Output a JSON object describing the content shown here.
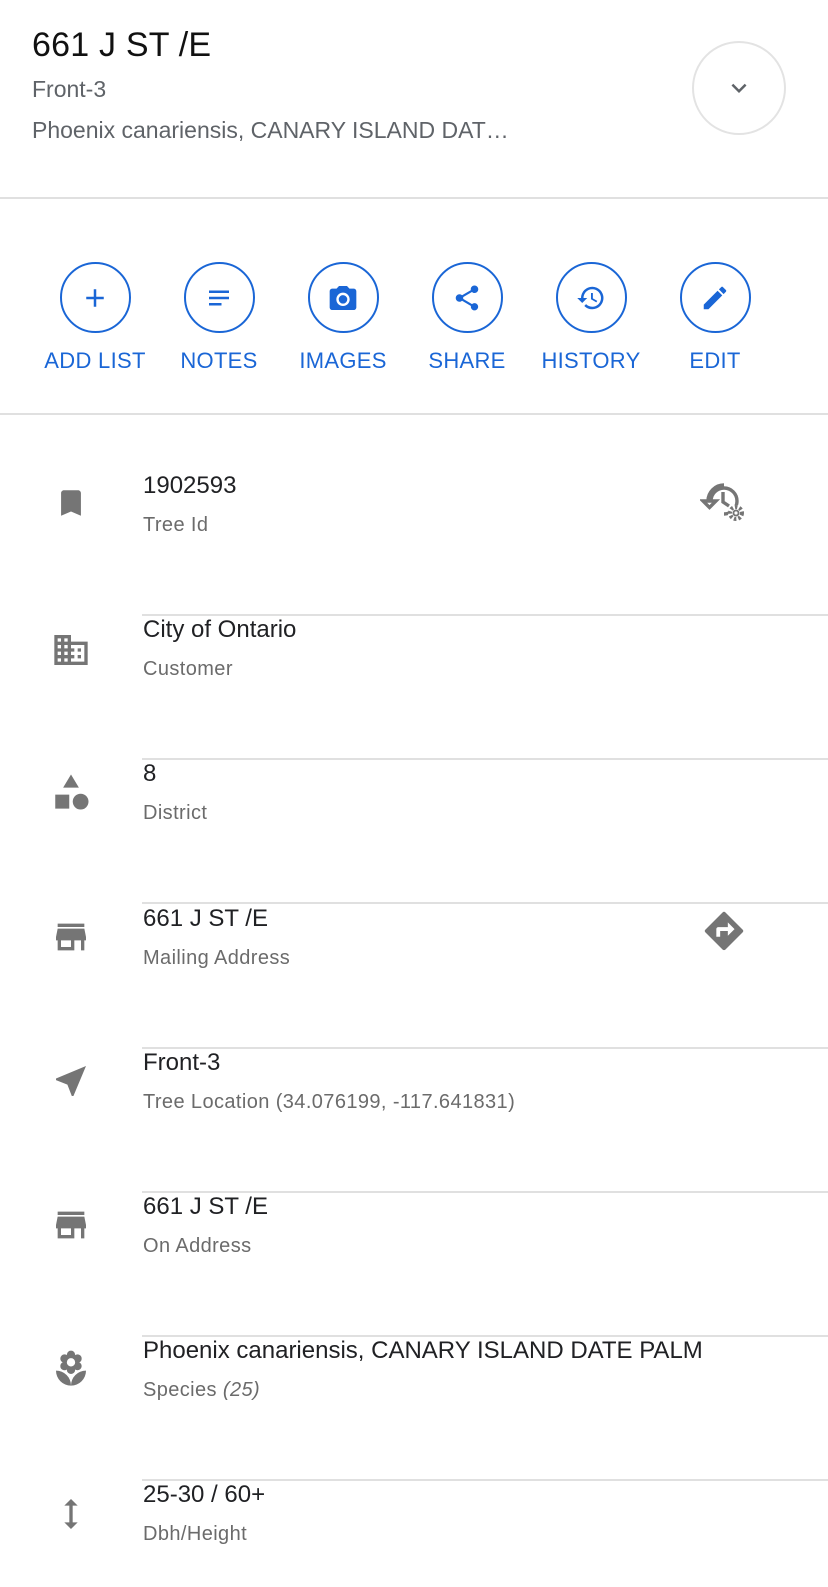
{
  "header": {
    "title": "661 J ST /E",
    "subtitle": "Front-3",
    "species": "Phoenix canariensis, CANARY ISLAND DAT…"
  },
  "actions": [
    {
      "label": "ADD LIST",
      "icon": "plus-icon"
    },
    {
      "label": "NOTES",
      "icon": "notes-icon"
    },
    {
      "label": "IMAGES",
      "icon": "camera-icon"
    },
    {
      "label": "SHARE",
      "icon": "share-icon"
    },
    {
      "label": "HISTORY",
      "icon": "history-icon"
    },
    {
      "label": "EDIT",
      "icon": "pencil-icon"
    }
  ],
  "details": [
    {
      "value": "1902593",
      "label": "Tree Id",
      "icon": "bookmark-icon",
      "trailing_icon": "history-settings-icon"
    },
    {
      "value": "City of Ontario",
      "label": "Customer",
      "icon": "building-icon"
    },
    {
      "value": "8",
      "label": "District",
      "icon": "shapes-icon"
    },
    {
      "value": "661 J ST /E",
      "label": "Mailing Address",
      "icon": "storefront-icon",
      "trailing_icon": "directions-icon"
    },
    {
      "value": "Front-3",
      "label": "Tree Location (34.076199, -117.641831)",
      "icon": "navigation-arrow-icon"
    },
    {
      "value": "661 J ST /E",
      "label": "On Address",
      "icon": "storefront-icon"
    },
    {
      "value": "Phoenix canariensis, CANARY ISLAND DATE PALM",
      "label": "Species",
      "label_count": "(25)",
      "icon": "flower-icon"
    },
    {
      "value": "25-30 / 60+",
      "label": "Dbh/Height",
      "icon": "vertical-arrows-icon"
    }
  ],
  "colors": {
    "accent": "#1a66d6",
    "icon_gray": "#757575",
    "divider": "#e0e0e0"
  }
}
